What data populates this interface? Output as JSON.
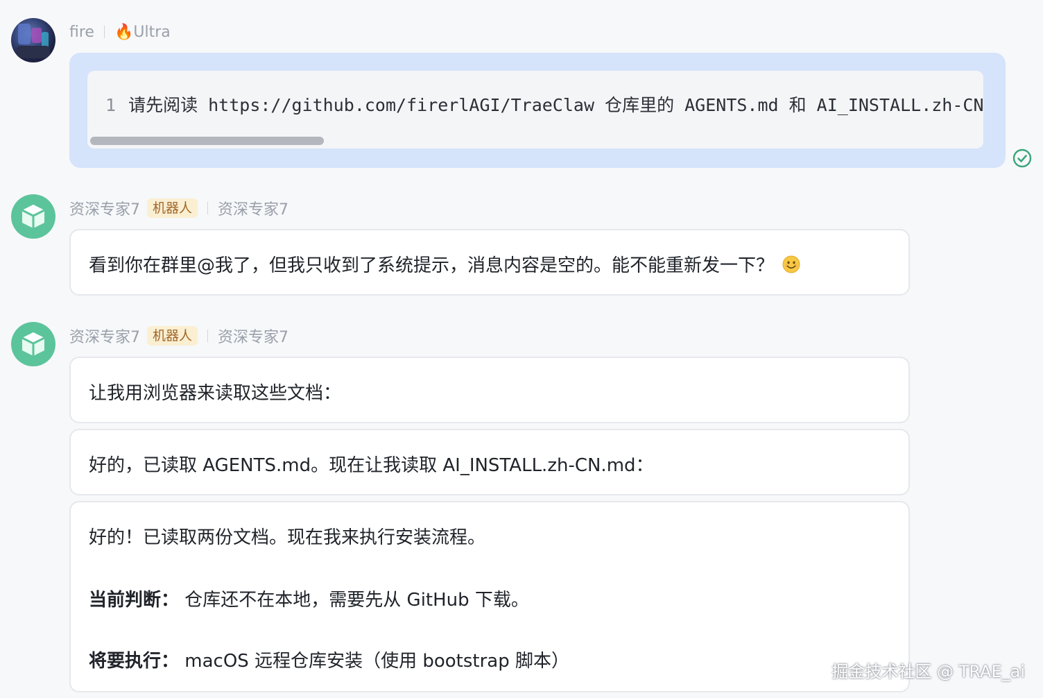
{
  "user_message": {
    "name": "fire",
    "badge": "🔥Ultra",
    "code_line_number": "1",
    "code_text": "请先阅读 https://github.com/firerlAGI/TraeClaw 仓库里的 AGENTS.md 和 AI_INSTALL.zh-CN.md",
    "status_icon": "check-circle-icon"
  },
  "bot_messages": [
    {
      "name": "资深专家7",
      "role_badge": "机器人",
      "alias": "资深专家7",
      "text": "看到你在群里@我了，但我只收到了系统提示，消息内容是空的。能不能重新发一下？",
      "emoji": "smile-emoji"
    },
    {
      "name": "资深专家7",
      "role_badge": "机器人",
      "alias": "资深专家7",
      "cards": [
        {
          "text": "让我用浏览器来读取这些文档："
        },
        {
          "text": "好的，已读取 AGENTS.md。现在让我读取 AI_INSTALL.zh-CN.md："
        }
      ],
      "summary": {
        "intro": "好的！已读取两份文档。现在我来执行安装流程。",
        "judgment_label": "当前判断：",
        "judgment_text": "仓库还不在本地，需要先从 GitHub 下载。",
        "action_label": "将要执行：",
        "action_text": "macOS 远程仓库安装（使用 bootstrap 脚本）"
      }
    }
  ],
  "watermark": "掘金技术社区 @ TRAE_ai",
  "colors": {
    "user_bubble": "#d5e3fb",
    "bot_avatar": "#5cc49b",
    "badge_bg": "#fbefd2",
    "badge_text": "#a0672a",
    "check": "#3aa57a"
  }
}
